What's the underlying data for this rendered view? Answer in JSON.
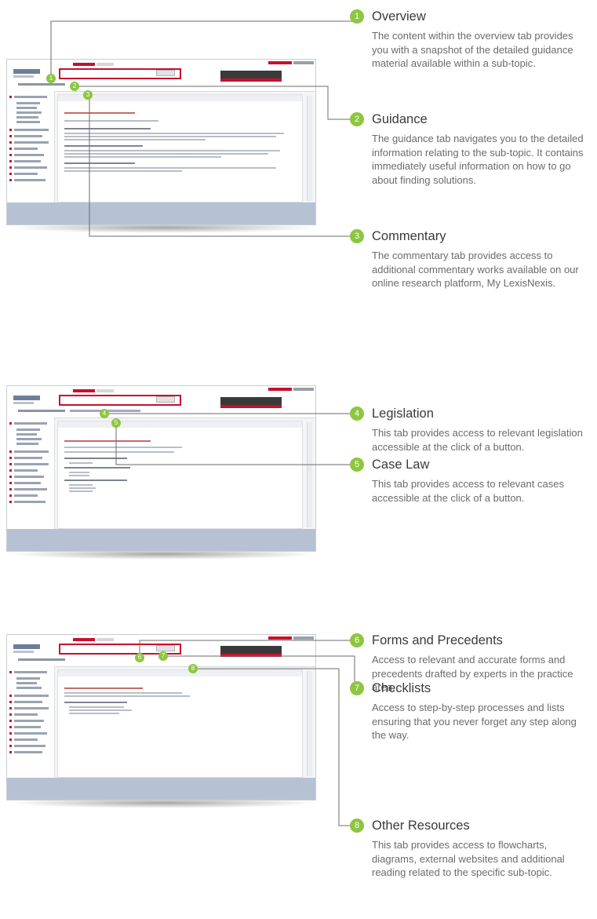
{
  "callouts": [
    {
      "num": "1",
      "title": "Overview",
      "text": "The content within the overview tab provides you with a snapshot of the detailed guidance material available within a sub-topic."
    },
    {
      "num": "2",
      "title": "Guidance",
      "text": "The guidance tab navigates you to the detailed information relating to the sub-topic. It contains immediately useful information on how to go about finding solutions."
    },
    {
      "num": "3",
      "title": "Commentary",
      "text": "The commentary tab provides access to additional commentary works available on our online research platform, My LexisNexis."
    },
    {
      "num": "4",
      "title": "Legislation",
      "text": "This tab provides access to relevant legislation accessible at the click of a button."
    },
    {
      "num": "5",
      "title": "Case Law",
      "text": "This tab provides access to relevant cases accessible at the click of a button."
    },
    {
      "num": "6",
      "title": "Forms and Precedents",
      "text": "Access to relevant and accurate forms and precedents drafted by experts in the practice area."
    },
    {
      "num": "7",
      "title": "Checklists",
      "text": "Access to step-by-step processes and lists ensuring that you never forget any step along the way."
    },
    {
      "num": "8",
      "title": "Other Resources",
      "text": "This tab provides access to flowcharts, diagrams, external websites and additional reading related to the specific sub-topic."
    }
  ],
  "colors": {
    "accent": "#8dc63f",
    "brand_red": "#c8102e",
    "connector": "#6b6b6b"
  },
  "icons": {
    "marker": "numbered-circle-icon"
  }
}
